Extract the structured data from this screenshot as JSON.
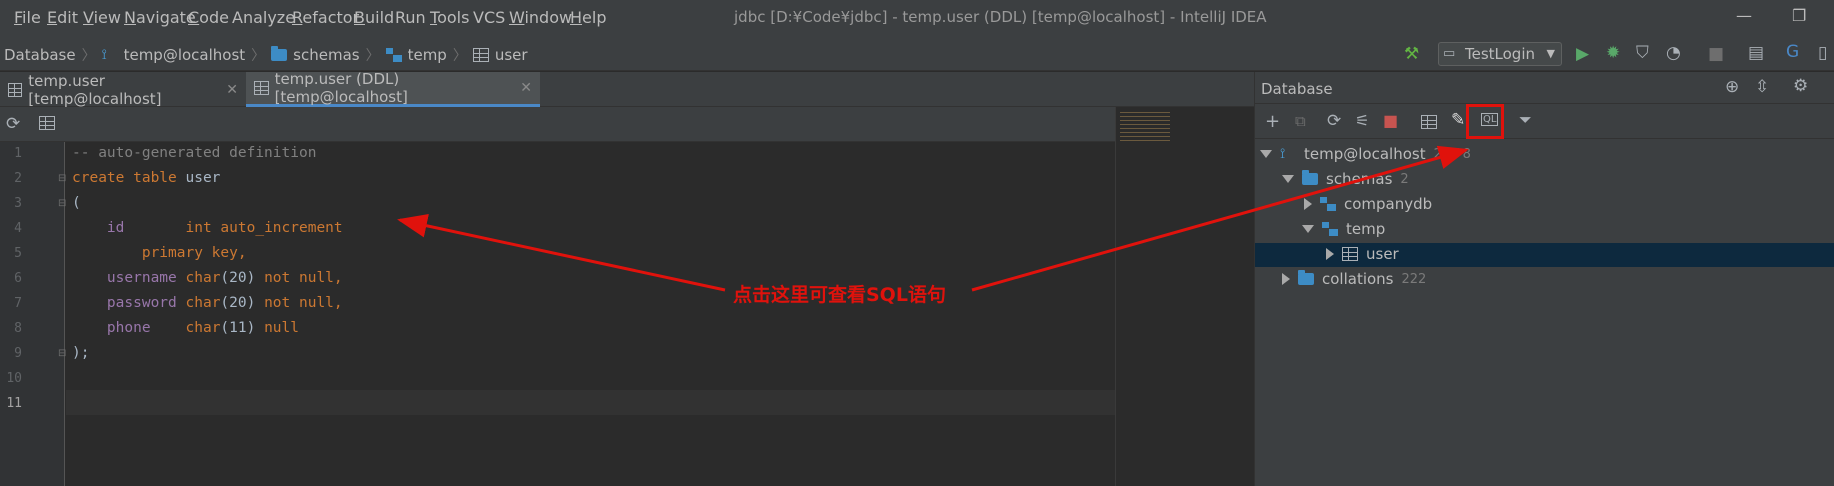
{
  "menu": {
    "items": [
      {
        "label": "File",
        "u": "F",
        "rest": "ile"
      },
      {
        "label": "Edit",
        "u": "E",
        "rest": "dit"
      },
      {
        "label": "View",
        "u": "V",
        "rest": "iew"
      },
      {
        "label": "Navigate",
        "u": "N",
        "rest": "avigate"
      },
      {
        "label": "Code",
        "u": "C",
        "rest": "ode"
      },
      {
        "label": "Analyze",
        "u": "",
        "rest": "Analyze"
      },
      {
        "label": "Refactor",
        "u": "R",
        "rest": "efactor"
      },
      {
        "label": "Build",
        "u": "B",
        "rest": "uild"
      },
      {
        "label": "Run",
        "u": "",
        "rest": "Run"
      },
      {
        "label": "Tools",
        "u": "T",
        "rest": "ools"
      },
      {
        "label": "VCS",
        "u": "",
        "rest": "VCS"
      },
      {
        "label": "Window",
        "u": "W",
        "rest": "indow"
      },
      {
        "label": "Help",
        "u": "H",
        "rest": "elp"
      }
    ],
    "title": "jdbc [D:¥Code¥jdbc] - temp.user (DDL) [temp@localhost] - IntelliJ IDEA",
    "minimize": "—",
    "maximize": "❐"
  },
  "breadcrumb": {
    "database": "Database",
    "host": "temp@localhost",
    "schemas": "schemas",
    "temp": "temp",
    "user": "user"
  },
  "run_config": {
    "label": "TestLogin"
  },
  "tabs": [
    {
      "label": "temp.user [temp@localhost]",
      "active": false
    },
    {
      "label": "temp.user (DDL) [temp@localhost]",
      "active": true
    }
  ],
  "editor": {
    "line_numbers": [
      "1",
      "2",
      "3",
      "4",
      "5",
      "6",
      "7",
      "8",
      "9",
      "10",
      "11"
    ],
    "lines": {
      "l1": "-- auto-generated definition",
      "l2a": "create table",
      "l2b": " user",
      "l3": "(",
      "l4a": "    id       ",
      "l4b": "int auto_increment",
      "l5": "        primary key,",
      "l6a": "    username ",
      "l6b": "char",
      "l6c": "(20) ",
      "l6d": "not null",
      "l6e": ",",
      "l7a": "    password ",
      "l7b": "char",
      "l7c": "(20) ",
      "l7d": "not null",
      "l7e": ",",
      "l8a": "    phone    ",
      "l8b": "char",
      "l8c": "(11) ",
      "l8d": "null",
      "l9": ");"
    }
  },
  "db_panel": {
    "title": "Database",
    "tree": {
      "host": {
        "label": "temp@localhost",
        "count": "2 of 8"
      },
      "schemas": {
        "label": "schemas",
        "count": "2"
      },
      "companydb": {
        "label": "companydb"
      },
      "temp": {
        "label": "temp"
      },
      "user": {
        "label": "user"
      },
      "collations": {
        "label": "collations",
        "count": "222"
      }
    }
  },
  "annotation": {
    "text": "点击这里可查看SQL语句"
  },
  "colors": {
    "annotation": "#e0120c",
    "accent": "#4a88c7"
  }
}
